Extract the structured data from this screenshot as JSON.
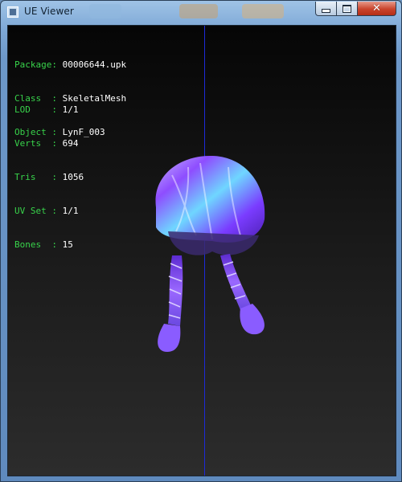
{
  "window": {
    "title": "UE Viewer"
  },
  "info_top": [
    {
      "key": "Package",
      "value": "00006644.upk"
    },
    {
      "key": "Class",
      "value": "SkeletalMesh"
    },
    {
      "key": "Object",
      "value": "LynF_003"
    }
  ],
  "info_stats": [
    {
      "key": "LOD",
      "value": "1/1"
    },
    {
      "key": "Verts",
      "value": "694"
    },
    {
      "key": "Tris",
      "value": "1056"
    },
    {
      "key": "UV Set",
      "value": "1/1"
    },
    {
      "key": "Bones",
      "value": "15"
    }
  ],
  "colors": {
    "label": "#38d34b",
    "value": "#ffffff",
    "axis": "#1d2ad8",
    "mesh_primary": "#7a3cff",
    "mesh_highlight": "#58d0ff"
  },
  "icons": {
    "window": "app-window-icon",
    "minimize": "minimize-icon",
    "maximize": "maximize-icon",
    "close": "close-icon"
  }
}
